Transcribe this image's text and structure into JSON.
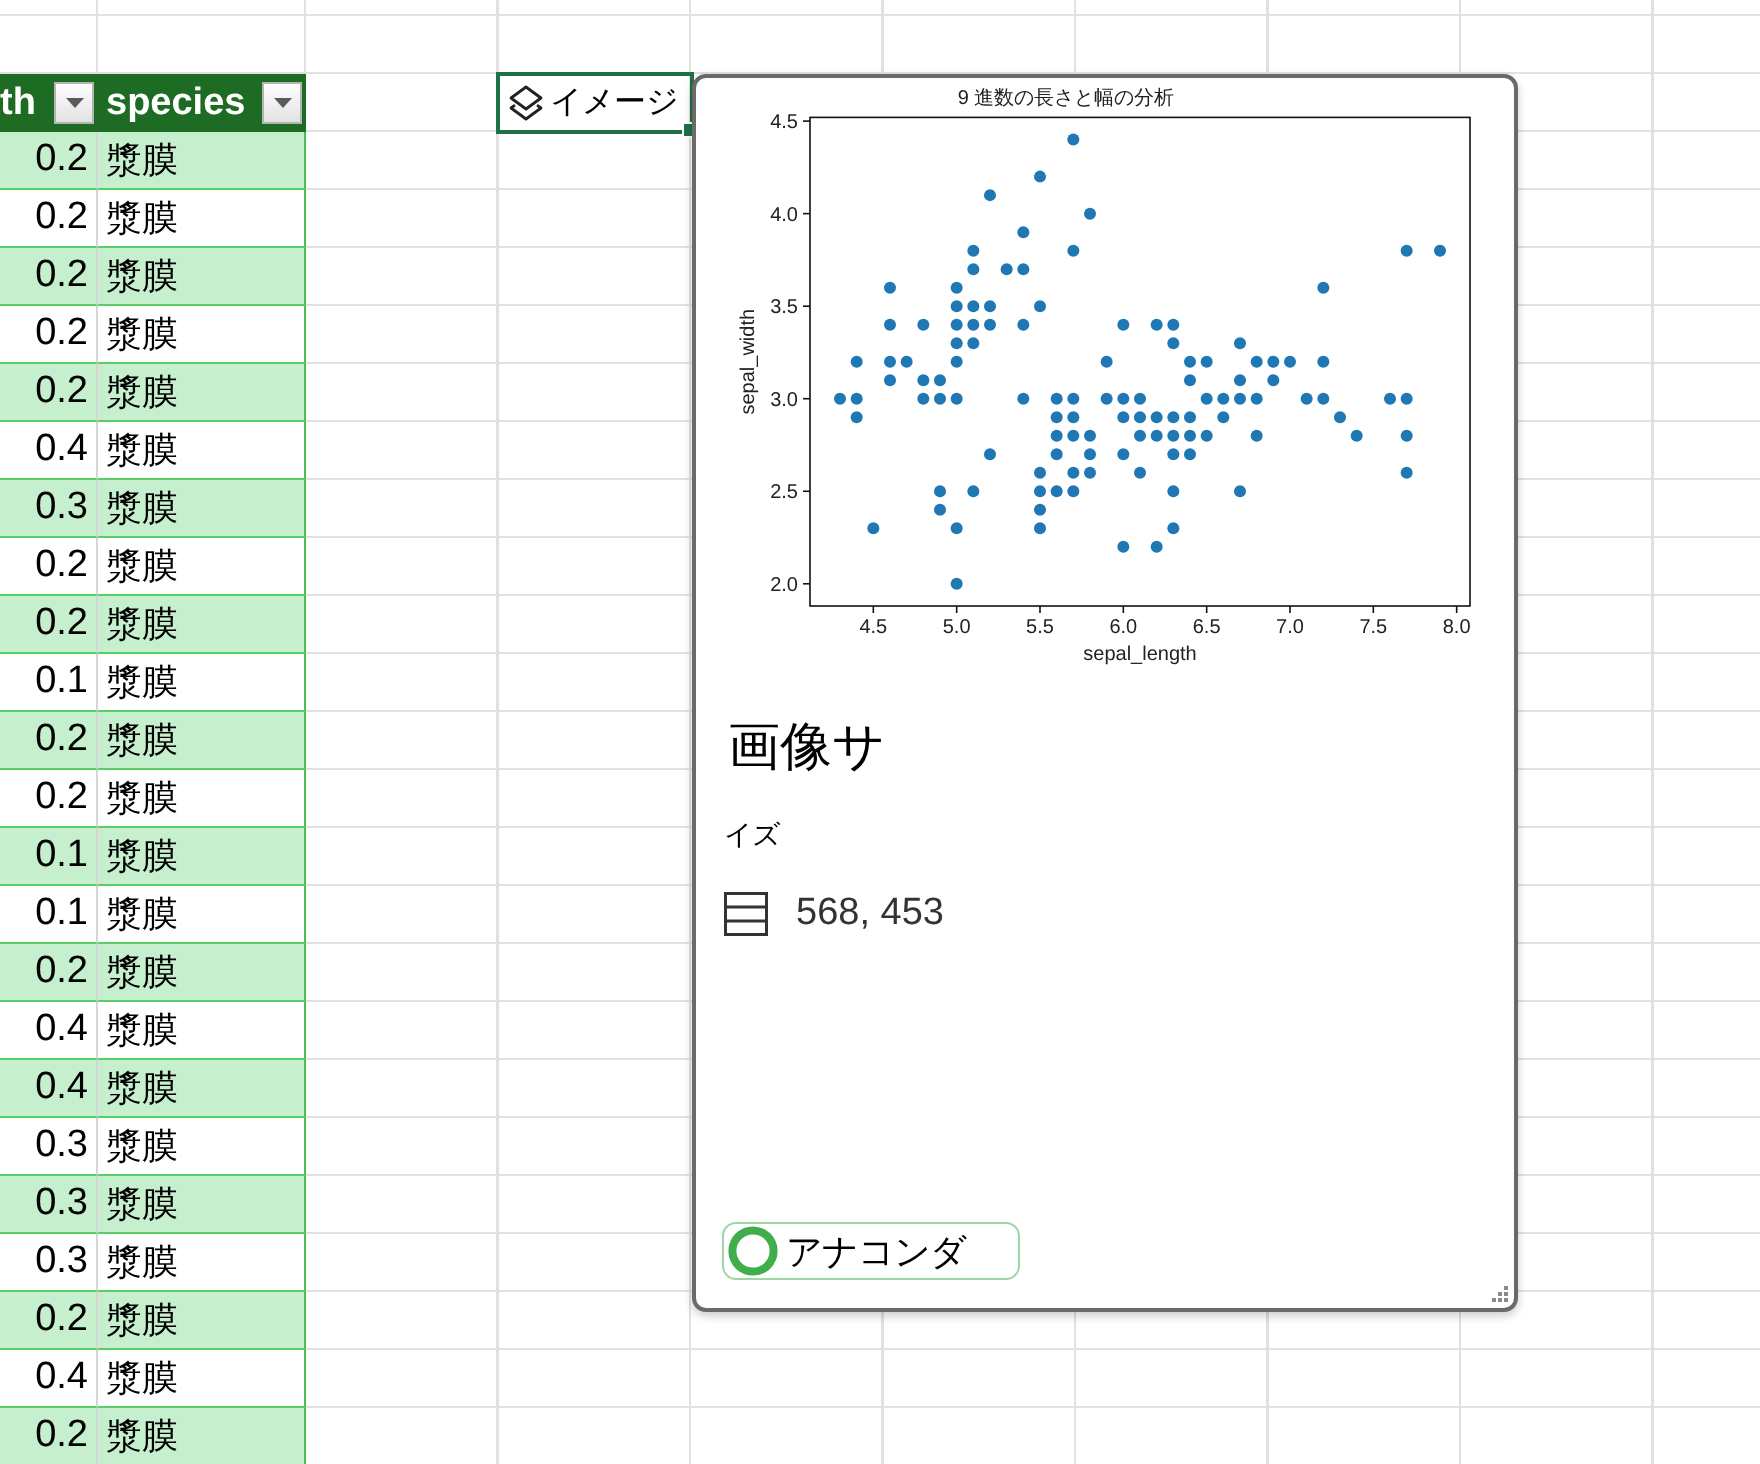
{
  "sheet": {
    "columns": [
      {
        "label": "th"
      },
      {
        "label": "species"
      }
    ],
    "rows": [
      {
        "cells": [
          "0.2",
          "漿膜"
        ]
      },
      {
        "cells": [
          "0.2",
          "漿膜"
        ]
      },
      {
        "cells": [
          "0.2",
          "漿膜"
        ]
      },
      {
        "cells": [
          "0.2",
          "漿膜"
        ]
      },
      {
        "cells": [
          "0.2",
          "漿膜"
        ]
      },
      {
        "cells": [
          "0.4",
          "漿膜"
        ]
      },
      {
        "cells": [
          "0.3",
          "漿膜"
        ]
      },
      {
        "cells": [
          "0.2",
          "漿膜"
        ]
      },
      {
        "cells": [
          "0.2",
          "漿膜"
        ]
      },
      {
        "cells": [
          "0.1",
          "漿膜"
        ]
      },
      {
        "cells": [
          "0.2",
          "漿膜"
        ]
      },
      {
        "cells": [
          "0.2",
          "漿膜"
        ]
      },
      {
        "cells": [
          "0.1",
          "漿膜"
        ]
      },
      {
        "cells": [
          "0.1",
          "漿膜"
        ]
      },
      {
        "cells": [
          "0.2",
          "漿膜"
        ]
      },
      {
        "cells": [
          "0.4",
          "漿膜"
        ]
      },
      {
        "cells": [
          "0.4",
          "漿膜"
        ]
      },
      {
        "cells": [
          "0.3",
          "漿膜"
        ]
      },
      {
        "cells": [
          "0.3",
          "漿膜"
        ]
      },
      {
        "cells": [
          "0.3",
          "漿膜"
        ]
      },
      {
        "cells": [
          "0.2",
          "漿膜"
        ]
      },
      {
        "cells": [
          "0.4",
          "漿膜"
        ]
      },
      {
        "cells": [
          "0.2",
          "漿膜"
        ]
      }
    ]
  },
  "image_cell": {
    "label": "イメージ",
    "selected": true
  },
  "card": {
    "chart_data": {
      "type": "scatter",
      "title": "9 進数の長さと幅の分析",
      "xlabel": "sepal_length",
      "ylabel": "sepal_width",
      "x": [
        4.3,
        4.4,
        4.4,
        4.4,
        4.5,
        4.6,
        4.6,
        4.6,
        4.6,
        4.7,
        4.8,
        4.8,
        4.8,
        4.9,
        4.9,
        4.9,
        4.9,
        5.0,
        5.0,
        5.0,
        5.0,
        5.0,
        5.0,
        5.0,
        5.0,
        5.1,
        5.1,
        5.1,
        5.1,
        5.1,
        5.1,
        5.2,
        5.2,
        5.2,
        5.2,
        5.3,
        5.4,
        5.4,
        5.4,
        5.4,
        5.5,
        5.5,
        5.5,
        5.5,
        5.5,
        5.5,
        5.6,
        5.6,
        5.6,
        5.6,
        5.6,
        5.7,
        5.7,
        5.7,
        5.7,
        5.7,
        5.7,
        5.7,
        5.8,
        5.8,
        5.8,
        5.8,
        5.9,
        5.9,
        6.0,
        6.0,
        6.0,
        6.0,
        6.0,
        6.1,
        6.1,
        6.1,
        6.1,
        6.2,
        6.2,
        6.2,
        6.2,
        6.3,
        6.3,
        6.3,
        6.3,
        6.3,
        6.3,
        6.3,
        6.4,
        6.4,
        6.4,
        6.4,
        6.4,
        6.5,
        6.5,
        6.5,
        6.6,
        6.6,
        6.7,
        6.7,
        6.7,
        6.7,
        6.8,
        6.8,
        6.8,
        6.9,
        6.9,
        7.0,
        7.1,
        7.2,
        7.2,
        7.2,
        7.3,
        7.4,
        7.6,
        7.7,
        7.7,
        7.7,
        7.7,
        7.9
      ],
      "series": [
        {
          "color": "#1f77b4",
          "values": [
            3.0,
            3.2,
            3.0,
            2.9,
            2.3,
            3.6,
            3.4,
            3.2,
            3.1,
            3.2,
            3.4,
            3.1,
            3.0,
            3.1,
            3.0,
            2.5,
            2.4,
            3.6,
            3.5,
            3.4,
            3.3,
            3.2,
            3.0,
            2.3,
            2.0,
            3.8,
            3.7,
            3.5,
            3.4,
            3.3,
            2.5,
            4.1,
            3.5,
            3.4,
            2.7,
            3.7,
            3.9,
            3.7,
            3.4,
            3.0,
            4.2,
            3.5,
            2.6,
            2.5,
            2.4,
            2.3,
            3.0,
            2.9,
            2.8,
            2.7,
            2.5,
            4.4,
            3.8,
            3.0,
            2.9,
            2.8,
            2.6,
            2.5,
            4.0,
            2.8,
            2.7,
            2.6,
            3.2,
            3.0,
            3.4,
            3.0,
            2.9,
            2.7,
            2.2,
            3.0,
            2.9,
            2.8,
            2.6,
            3.4,
            2.9,
            2.8,
            2.2,
            3.4,
            3.3,
            2.9,
            2.8,
            2.7,
            2.5,
            2.3,
            3.2,
            3.1,
            2.9,
            2.8,
            2.7,
            3.2,
            3.0,
            2.8,
            3.0,
            2.9,
            3.3,
            3.1,
            3.0,
            2.5,
            3.2,
            3.0,
            2.8,
            3.2,
            3.1,
            3.2,
            3.0,
            3.6,
            3.2,
            3.0,
            2.9,
            2.8,
            3.0,
            3.8,
            3.0,
            2.8,
            2.6,
            3.8
          ]
        }
      ],
      "xlim": [
        4.12,
        8.08
      ],
      "ylim": [
        1.88,
        4.52
      ],
      "xticks": [
        {
          "value": 4.5,
          "label": "4.5"
        },
        {
          "value": 5.0,
          "label": "5.0"
        },
        {
          "value": 5.5,
          "label": "5.5"
        },
        {
          "value": 6.0,
          "label": "6.0"
        },
        {
          "value": 6.5,
          "label": "6.5"
        },
        {
          "value": 7.0,
          "label": "7.0"
        },
        {
          "value": 7.5,
          "label": "7.5"
        },
        {
          "value": 8.0,
          "label": "8.0"
        }
      ],
      "yticks": [
        {
          "value": 2.0,
          "label": "2.0"
        },
        {
          "value": 2.5,
          "label": "2.5"
        },
        {
          "value": 3.0,
          "label": "3.0"
        },
        {
          "value": 3.5,
          "label": "3.5"
        },
        {
          "value": 4.0,
          "label": "4.0"
        },
        {
          "value": 4.5,
          "label": "4.5"
        }
      ]
    },
    "title": "画像サ",
    "subtitle": "イズ",
    "dimensions": "568, 453",
    "environment": "アナコンダ"
  }
}
